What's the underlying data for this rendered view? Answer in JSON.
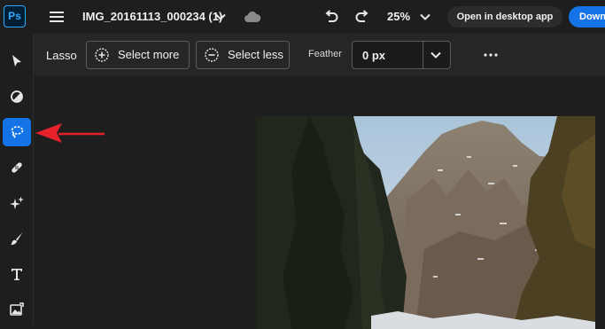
{
  "app": {
    "logo_text": "Ps"
  },
  "header": {
    "document_title": "IMG_20161113_000234 (1)",
    "zoom_level": "25%",
    "open_desktop_label": "Open in desktop app",
    "download_label": "Down"
  },
  "options": {
    "tool_name": "Lasso",
    "select_more_label": "Select more",
    "select_less_label": "Select less",
    "feather_label": "Feather",
    "feather_value": "0 px"
  },
  "toolbar": {
    "tools": [
      {
        "name": "select",
        "icon": "arrow-pointer-icon"
      },
      {
        "name": "adjust",
        "icon": "contrast-icon"
      },
      {
        "name": "lasso",
        "icon": "lasso-icon",
        "active": true
      },
      {
        "name": "heal",
        "icon": "bandage-icon"
      },
      {
        "name": "magic",
        "icon": "sparkle-icon"
      },
      {
        "name": "brush",
        "icon": "brush-icon"
      },
      {
        "name": "text",
        "icon": "type-icon"
      },
      {
        "name": "image",
        "icon": "image-edit-icon"
      }
    ]
  },
  "colors": {
    "accent": "#1473e6",
    "annotation": "#e8202a",
    "background": "#1e1e1e"
  }
}
